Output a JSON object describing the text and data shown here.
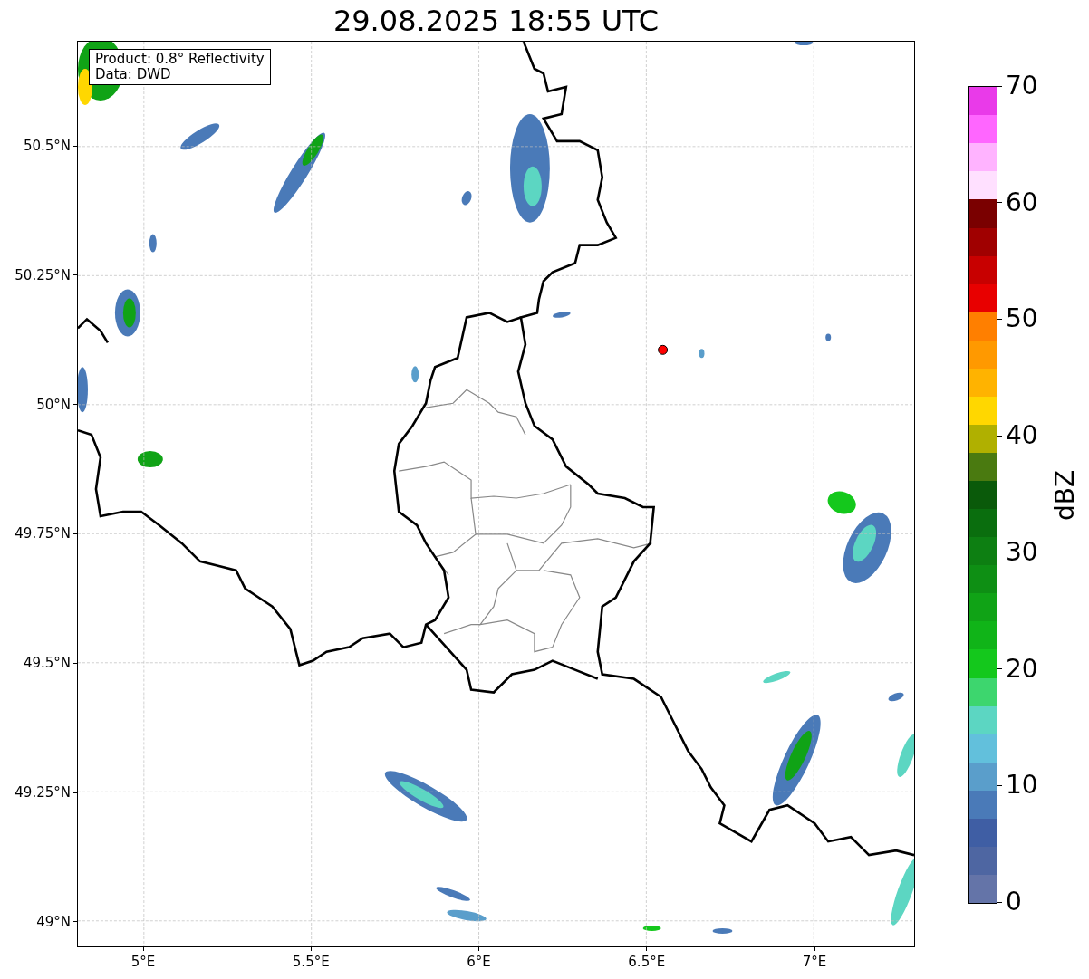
{
  "title": "29.08.2025 18:55 UTC",
  "annotation": [
    "Product: 0.8° Reflectivity",
    "Data: DWD"
  ],
  "x_ticks": [
    "5°E",
    "5.5°E",
    "6°E",
    "6.5°E",
    "7°E"
  ],
  "y_ticks": [
    "50.5°N",
    "50.25°N",
    "50°N",
    "49.75°N",
    "49.5°N",
    "49.25°N",
    "49°N"
  ],
  "colorbar": {
    "label": "dBZ",
    "ticks": [
      "70",
      "60",
      "50",
      "40",
      "30",
      "20",
      "10",
      "0"
    ],
    "bins": [
      {
        "color": "#6474a8"
      },
      {
        "color": "#4e66a2"
      },
      {
        "color": "#3f5ea4"
      },
      {
        "color": "#4a7ab8"
      },
      {
        "color": "#5a9ecb"
      },
      {
        "color": "#62c0dc"
      },
      {
        "color": "#5cd6c2"
      },
      {
        "color": "#3dd66e"
      },
      {
        "color": "#14c81c"
      },
      {
        "color": "#10b418"
      },
      {
        "color": "#10a316"
      },
      {
        "color": "#0e8f14"
      },
      {
        "color": "#0d7f12"
      },
      {
        "color": "#0a6e0e"
      },
      {
        "color": "#0a5a0a"
      },
      {
        "color": "#4a7a10"
      },
      {
        "color": "#b0b000"
      },
      {
        "color": "#ffd700"
      },
      {
        "color": "#ffb300"
      },
      {
        "color": "#ff9900"
      },
      {
        "color": "#ff7f00"
      },
      {
        "color": "#e80000"
      },
      {
        "color": "#c80000"
      },
      {
        "color": "#a00000"
      },
      {
        "color": "#7a0000"
      },
      {
        "color": "#ffe0ff"
      },
      {
        "color": "#ffb3ff"
      },
      {
        "color": "#ff66ff"
      },
      {
        "color": "#e93ae9"
      }
    ]
  }
}
